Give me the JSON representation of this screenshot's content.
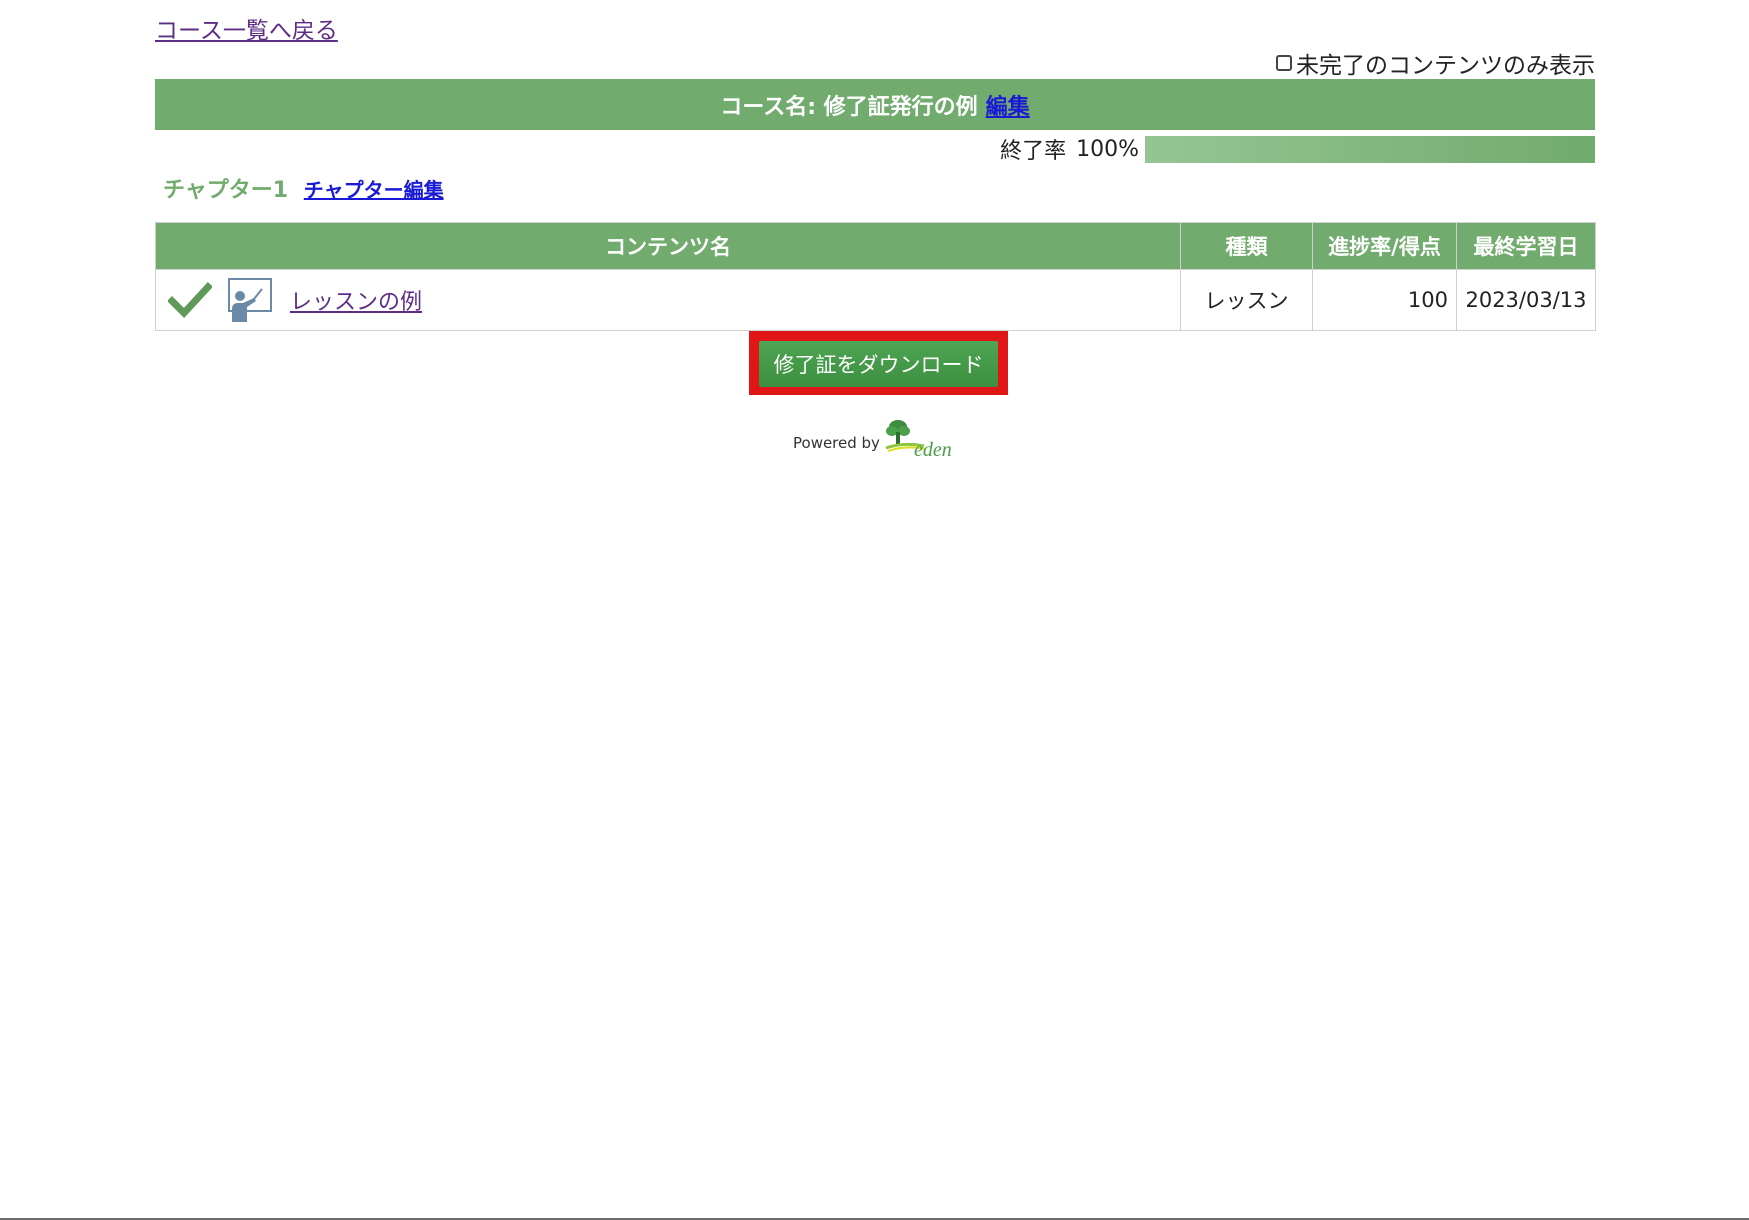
{
  "nav": {
    "back_link": "コース一覧へ戻る",
    "filter_label": "未完了のコンテンツのみ表示"
  },
  "course": {
    "header_label": "コース名: 修了証発行の例",
    "edit_label": "編集",
    "progress_label": "終了率",
    "progress_text": "100%",
    "progress_fraction": 1.0
  },
  "chapter": {
    "title": "チャプター1",
    "edit_label": "チャプター編集"
  },
  "table": {
    "headers": {
      "name": "コンテンツ名",
      "type": "種類",
      "progress": "進捗率/得点",
      "last_date": "最終学習日"
    },
    "rows": [
      {
        "name": "レッスンの例",
        "type": "レッスン",
        "score": "100",
        "last_date": "2023/03/13",
        "status_icon": "check-icon",
        "type_icon": "lesson-presenter-icon"
      }
    ]
  },
  "download": {
    "label": "修了証をダウンロード"
  },
  "footer": {
    "powered_by": "Powered by",
    "logo_text": "eden"
  },
  "colors": {
    "accent_green": "#72ab6e",
    "button_green": "#4ea553",
    "highlight_red": "#e01515",
    "link_purple": "#5e2e86",
    "link_blue": "#1a1ad6"
  }
}
